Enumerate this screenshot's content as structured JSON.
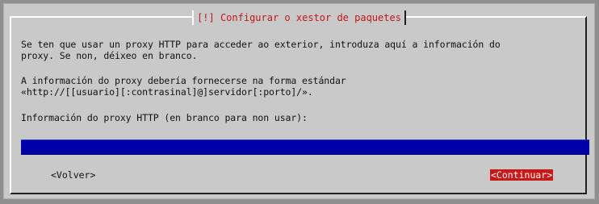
{
  "dialog": {
    "title": "[!] Configurar o xestor de paquetes",
    "paragraph1_line1": "Se ten que usar un proxy HTTP para acceder ao exterior, introduza aquí a información do",
    "paragraph1_line2": "proxy. Se non, déixeo en branco.",
    "paragraph2_line1": "A información do proxy debería fornecerse na forma estándar",
    "paragraph2_line2": "«http://[[usuario][:contrasinal]@]servidor[:porto]/».",
    "prompt": "Información do proxy HTTP (en branco para non usar):"
  },
  "input": {
    "value": ""
  },
  "buttons": {
    "back": "<Volver>",
    "continue": "<Continuar>"
  },
  "colors": {
    "background": "#c9c9c9",
    "title": "#c01818",
    "input_bg": "#0000a8",
    "focused_button_bg": "#c81818"
  }
}
